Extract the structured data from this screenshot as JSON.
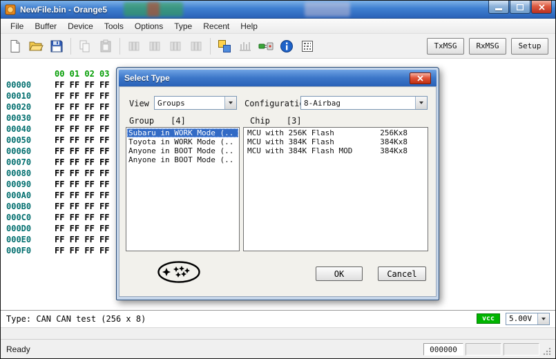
{
  "window": {
    "title": "NewFile.bin - Orange5"
  },
  "menu": {
    "items": [
      "File",
      "Buffer",
      "Device",
      "Tools",
      "Options",
      "Type",
      "Recent",
      "Help"
    ]
  },
  "toolbar": {
    "text_buttons": [
      "TxMSG",
      "RxMSG",
      "Setup"
    ],
    "icon_names": [
      "new-file",
      "open-file",
      "save-file",
      "copy",
      "paste",
      "buffer-1",
      "buffer-2",
      "buffer-3",
      "buffer-4",
      "swap-buffers",
      "pins",
      "connect-device",
      "info",
      "checksum"
    ]
  },
  "hex": {
    "col_header": "00 01 02 03",
    "rows": [
      {
        "addr": "00000",
        "bytes": "FF FF FF FF"
      },
      {
        "addr": "00010",
        "bytes": "FF FF FF FF"
      },
      {
        "addr": "00020",
        "bytes": "FF FF FF FF"
      },
      {
        "addr": "00030",
        "bytes": "FF FF FF FF"
      },
      {
        "addr": "00040",
        "bytes": "FF FF FF FF"
      },
      {
        "addr": "00050",
        "bytes": "FF FF FF FF"
      },
      {
        "addr": "00060",
        "bytes": "FF FF FF FF"
      },
      {
        "addr": "00070",
        "bytes": "FF FF FF FF"
      },
      {
        "addr": "00080",
        "bytes": "FF FF FF FF"
      },
      {
        "addr": "00090",
        "bytes": "FF FF FF FF"
      },
      {
        "addr": "000A0",
        "bytes": "FF FF FF FF"
      },
      {
        "addr": "000B0",
        "bytes": "FF FF FF FF"
      },
      {
        "addr": "000C0",
        "bytes": "FF FF FF FF"
      },
      {
        "addr": "000D0",
        "bytes": "FF FF FF FF"
      },
      {
        "addr": "000E0",
        "bytes": "FF FF FF FF"
      },
      {
        "addr": "000F0",
        "bytes": "FF FF FF FF"
      }
    ]
  },
  "dialog": {
    "title": "Select Type",
    "view_label": "View",
    "view_value": "Groups",
    "config_label": "Configuratio",
    "config_value": "8-Airbag",
    "group_label": "Group",
    "group_count": "[4]",
    "group_selected_index": 0,
    "group_items": [
      "Subaru in WORK Mode (..",
      "Toyota in WORK Mode (..",
      "Anyone in BOOT Mode (..",
      "Anyone in BOOT Mode (.."
    ],
    "chip_label": "Chip",
    "chip_count": "[3]",
    "chip_items": [
      {
        "name": "MCU with 256K Flash",
        "size": "256Kx8"
      },
      {
        "name": "MCU with 384K Flash",
        "size": "384Kx8"
      },
      {
        "name": "MCU with 384K Flash MOD",
        "size": "384Kx8"
      }
    ],
    "ok_label": "OK",
    "cancel_label": "Cancel"
  },
  "status": {
    "type_line": "Type: CAN CAN test (256 x 8)",
    "vcc_label": "vcc",
    "voltage": "5.00V"
  },
  "statusbar": {
    "ready": "Ready",
    "offset": "000000"
  },
  "colors": {
    "titlebar_blue": "#3f7fd0",
    "address_green": "#006e6e",
    "header_green": "#009c00",
    "selection_blue": "#316ac5",
    "vcc_green": "#00b400"
  }
}
